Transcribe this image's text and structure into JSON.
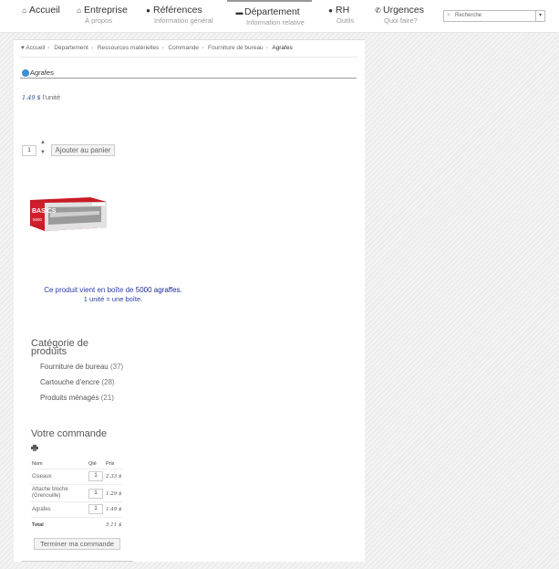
{
  "nav": {
    "accueil": "Accueil",
    "entreprise": {
      "label": "Entreprise",
      "sub": "À propos"
    },
    "references": {
      "label": "Références",
      "sub": "Information général"
    },
    "departement": {
      "label": "Département",
      "sub": "Information relative"
    },
    "rh": {
      "label": "RH",
      "sub": "Outils"
    },
    "urgences": {
      "label": "Urgences",
      "sub": "Quoi faire?"
    }
  },
  "search": {
    "placeholder": "Recherche"
  },
  "breadcrumb": {
    "items": [
      "Accueil",
      "Département",
      "Ressources matérielles",
      "Commande",
      "Fourniture de bureau"
    ],
    "current": "Agrafes"
  },
  "product": {
    "title": "Agrafes",
    "price": "1.49 $",
    "unit": "l'unité",
    "quantity": "1",
    "add_to_cart": "Ajouter au panier",
    "image_brand": "BASICS",
    "image_count": "5000",
    "desc_prefix": "Ce produit vient en boîte de",
    "desc_count": "5000 agraffes.",
    "desc_line2": "1 unité = une boîte."
  },
  "categories": {
    "title": "Catégorie de produits",
    "items": [
      {
        "name": "Fourniture de bureau",
        "count": "(37)"
      },
      {
        "name": "Cartouche d'encre",
        "count": "(28)"
      },
      {
        "name": "Produits ménagés",
        "count": "(21)"
      }
    ]
  },
  "order": {
    "title": "Votre commande",
    "headers": {
      "name": "Nom",
      "qty": "Qté",
      "price": "Prix"
    },
    "rows": [
      {
        "name": "Ciseaux",
        "qty": "1",
        "price": "2.33 $"
      },
      {
        "name": "Attache bloche (Grenouille)",
        "qty": "1",
        "price": "1.29 $"
      },
      {
        "name": "Agrafes",
        "qty": "1",
        "price": "1.49 $"
      }
    ],
    "total_label": "Total",
    "total": "5.11 $",
    "finish": "Terminer ma commande"
  },
  "colors": {
    "link": "#2a3ea8",
    "price": "#2a4a8a",
    "accent_icon": "#3a8fd8",
    "box_red": "#d01f2a"
  }
}
